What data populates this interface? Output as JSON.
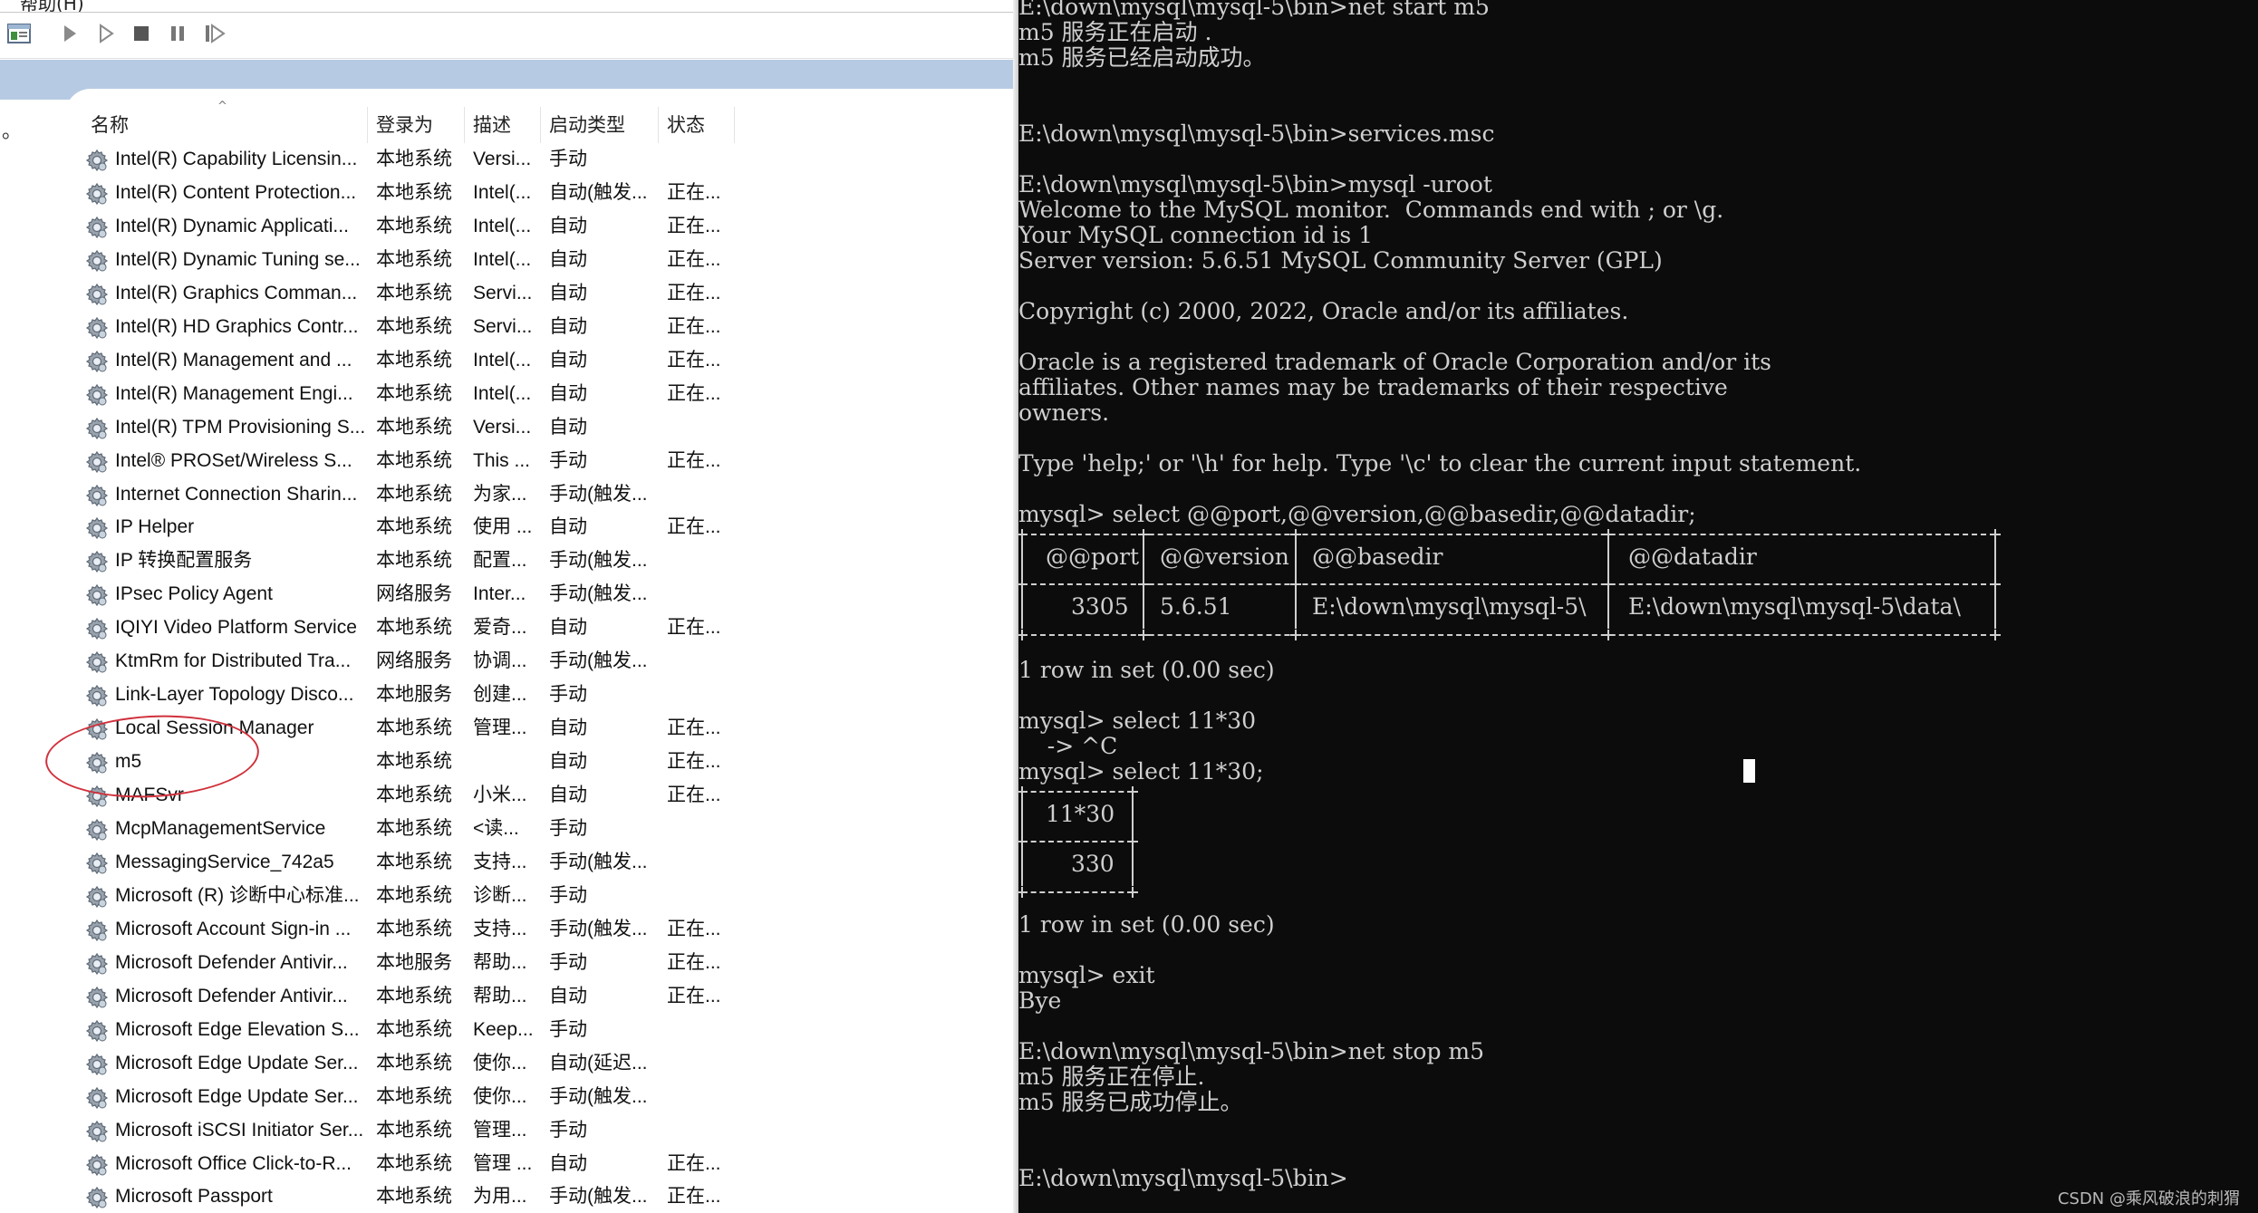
{
  "services_window": {
    "menu_partial": "帮助(H)",
    "toolbar": {
      "icons": [
        "console-view-icon",
        "start-service-icon",
        "start-next-icon",
        "stop-service-icon",
        "pause-service-icon",
        "restart-service-icon"
      ]
    },
    "columns": {
      "name": "名称",
      "logon": "登录为",
      "desc": "描述",
      "start": "启动类型",
      "state": "状态"
    },
    "left_dot": "。",
    "rows": [
      {
        "name": "Intel(R) Capability Licensin...",
        "logon": "本地系统",
        "desc": "Versi...",
        "start": "手动",
        "state": ""
      },
      {
        "name": "Intel(R) Content Protection...",
        "logon": "本地系统",
        "desc": "Intel(...",
        "start": "自动(触发...",
        "state": "正在..."
      },
      {
        "name": "Intel(R) Dynamic Applicati...",
        "logon": "本地系统",
        "desc": "Intel(...",
        "start": "自动",
        "state": "正在..."
      },
      {
        "name": "Intel(R) Dynamic Tuning se...",
        "logon": "本地系统",
        "desc": "Intel(...",
        "start": "自动",
        "state": "正在..."
      },
      {
        "name": "Intel(R) Graphics Comman...",
        "logon": "本地系统",
        "desc": "Servi...",
        "start": "自动",
        "state": "正在..."
      },
      {
        "name": "Intel(R) HD Graphics Contr...",
        "logon": "本地系统",
        "desc": "Servi...",
        "start": "自动",
        "state": "正在..."
      },
      {
        "name": "Intel(R) Management and ...",
        "logon": "本地系统",
        "desc": "Intel(...",
        "start": "自动",
        "state": "正在..."
      },
      {
        "name": "Intel(R) Management Engi...",
        "logon": "本地系统",
        "desc": "Intel(...",
        "start": "自动",
        "state": "正在..."
      },
      {
        "name": "Intel(R) TPM Provisioning S...",
        "logon": "本地系统",
        "desc": "Versi...",
        "start": "自动",
        "state": ""
      },
      {
        "name": "Intel® PROSet/Wireless S...",
        "logon": "本地系统",
        "desc": "This ...",
        "start": "手动",
        "state": "正在..."
      },
      {
        "name": "Internet Connection Sharin...",
        "logon": "本地系统",
        "desc": "为家...",
        "start": "手动(触发...",
        "state": ""
      },
      {
        "name": "IP Helper",
        "logon": "本地系统",
        "desc": "使用 ...",
        "start": "自动",
        "state": "正在..."
      },
      {
        "name": "IP 转换配置服务",
        "logon": "本地系统",
        "desc": "配置...",
        "start": "手动(触发...",
        "state": ""
      },
      {
        "name": "IPsec Policy Agent",
        "logon": "网络服务",
        "desc": "Inter...",
        "start": "手动(触发...",
        "state": ""
      },
      {
        "name": "IQIYI Video Platform Service",
        "logon": "本地系统",
        "desc": "爱奇...",
        "start": "自动",
        "state": "正在..."
      },
      {
        "name": "KtmRm for Distributed Tra...",
        "logon": "网络服务",
        "desc": "协调...",
        "start": "手动(触发...",
        "state": ""
      },
      {
        "name": "Link-Layer Topology Disco...",
        "logon": "本地服务",
        "desc": "创建...",
        "start": "手动",
        "state": ""
      },
      {
        "name": "Local Session Manager",
        "logon": "本地系统",
        "desc": "管理...",
        "start": "自动",
        "state": "正在..."
      },
      {
        "name": "m5",
        "logon": "本地系统",
        "desc": "",
        "start": "自动",
        "state": "正在..."
      },
      {
        "name": "MAFSvr",
        "logon": "本地系统",
        "desc": "小米...",
        "start": "自动",
        "state": "正在..."
      },
      {
        "name": "McpManagementService",
        "logon": "本地系统",
        "desc": "<读...",
        "start": "手动",
        "state": ""
      },
      {
        "name": "MessagingService_742a5",
        "logon": "本地系统",
        "desc": "支持...",
        "start": "手动(触发...",
        "state": ""
      },
      {
        "name": "Microsoft (R) 诊断中心标准...",
        "logon": "本地系统",
        "desc": "诊断...",
        "start": "手动",
        "state": ""
      },
      {
        "name": "Microsoft Account Sign-in ...",
        "logon": "本地系统",
        "desc": "支持...",
        "start": "手动(触发...",
        "state": "正在..."
      },
      {
        "name": "Microsoft Defender Antivir...",
        "logon": "本地服务",
        "desc": "帮助...",
        "start": "手动",
        "state": "正在..."
      },
      {
        "name": "Microsoft Defender Antivir...",
        "logon": "本地系统",
        "desc": "帮助...",
        "start": "自动",
        "state": "正在..."
      },
      {
        "name": "Microsoft Edge Elevation S...",
        "logon": "本地系统",
        "desc": "Keep...",
        "start": "手动",
        "state": ""
      },
      {
        "name": "Microsoft Edge Update Ser...",
        "logon": "本地系统",
        "desc": "使你...",
        "start": "自动(延迟...",
        "state": ""
      },
      {
        "name": "Microsoft Edge Update Ser...",
        "logon": "本地系统",
        "desc": "使你...",
        "start": "手动(触发...",
        "state": ""
      },
      {
        "name": "Microsoft iSCSI Initiator Ser...",
        "logon": "本地系统",
        "desc": "管理...",
        "start": "手动",
        "state": ""
      },
      {
        "name": "Microsoft Office Click-to-R...",
        "logon": "本地系统",
        "desc": "管理 ...",
        "start": "自动",
        "state": "正在..."
      },
      {
        "name": "Microsoft Passport",
        "logon": "本地系统",
        "desc": "为用...",
        "start": "手动(触发...",
        "state": "正在..."
      }
    ]
  },
  "console": {
    "lines_top": [
      "E:\\down\\mysql\\mysql-5\\bin>net start m5",
      "m5 服务正在启动 .",
      "m5 服务已经启动成功。",
      "",
      "",
      "E:\\down\\mysql\\mysql-5\\bin>services.msc",
      "",
      "E:\\down\\mysql\\mysql-5\\bin>mysql -uroot",
      "Welcome to the MySQL monitor.  Commands end with ; or \\g.",
      "Your MySQL connection id is 1",
      "Server version: 5.6.51 MySQL Community Server (GPL)",
      "",
      "Copyright (c) 2000, 2022, Oracle and/or its affiliates.",
      "",
      "Oracle is a registered trademark of Oracle Corporation and/or its",
      "affiliates. Other names may be trademarks of their respective",
      "owners.",
      "",
      "Type 'help;' or '\\h' for help. Type '\\c' to clear the current input statement.",
      "",
      "mysql> select @@port,@@version,@@basedir,@@datadir;"
    ],
    "table1": {
      "headers": [
        "@@port",
        "@@version",
        "@@basedir",
        "@@datadir"
      ],
      "row": [
        "3305",
        "5.6.51",
        "E:\\down\\mysql\\mysql-5\\",
        "E:\\down\\mysql\\mysql-5\\data\\"
      ]
    },
    "lines_mid": [
      "1 row in set (0.00 sec)",
      "",
      "mysql> select 11*30",
      "    -> ^C",
      "mysql> select 11*30;"
    ],
    "table2": {
      "header": "11*30",
      "value": "330"
    },
    "lines_bottom": [
      "1 row in set (0.00 sec)",
      "",
      "mysql> exit",
      "Bye",
      "",
      "E:\\down\\mysql\\mysql-5\\bin>net stop m5",
      "m5 服务正在停止.",
      "m5 服务已成功停止。",
      "",
      "",
      "E:\\down\\mysql\\mysql-5\\bin>"
    ]
  },
  "watermark": "CSDN @乘风破浪的刺猬"
}
